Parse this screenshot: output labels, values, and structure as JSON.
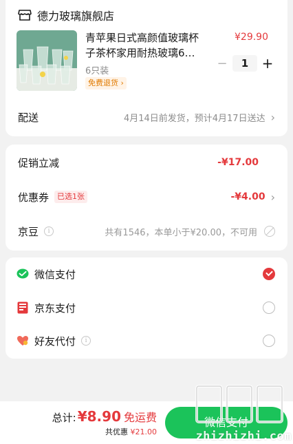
{
  "store": {
    "name": "德力玻璃旗舰店",
    "icon": "store-icon"
  },
  "product": {
    "title": "青苹果日式高颜值玻璃杯子茶杯家用耐热玻璃6…",
    "price": "¥29.90",
    "spec": "6只装",
    "return_badge": "免费退货",
    "quantity": "1",
    "minus": "−",
    "plus": "+"
  },
  "delivery": {
    "label": "配送",
    "info": "4月14日前发货，预计4月17日送达"
  },
  "discounts": {
    "promo_label": "促销立减",
    "promo_amount": "-¥17.00",
    "coupon_label": "优惠券",
    "coupon_badge": "已选1张",
    "coupon_amount": "-¥4.00",
    "beans_label": "京豆",
    "beans_info": "共有1546，本单小于¥20.00，不可用"
  },
  "payment": {
    "methods": [
      {
        "label": "微信支付",
        "icon": "wechat-pay-icon",
        "selected": true,
        "info_icon": false
      },
      {
        "label": "京东支付",
        "icon": "jd-pay-icon",
        "selected": false,
        "info_icon": false
      },
      {
        "label": "好友代付",
        "icon": "friend-pay-icon",
        "selected": false,
        "info_icon": true
      }
    ]
  },
  "footer": {
    "total_label": "总计:",
    "total_amount": "¥8.90",
    "free_shipping": "免运费",
    "saved_label": "共优惠",
    "saved_amount": "¥21.00",
    "pay_button": "微信支付"
  },
  "watermark": {
    "text": "zhizhizhi.com"
  },
  "colors": {
    "accent_red": "#e4393c",
    "wechat_green": "#1bc35a",
    "return_orange": "#e07a00"
  }
}
